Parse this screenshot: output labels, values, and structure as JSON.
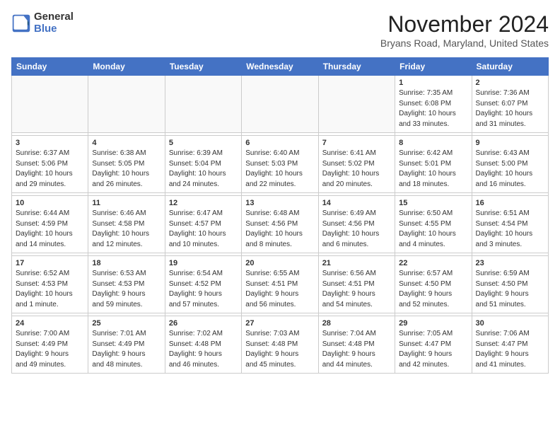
{
  "header": {
    "logo_general": "General",
    "logo_blue": "Blue",
    "month_title": "November 2024",
    "location": "Bryans Road, Maryland, United States"
  },
  "weekdays": [
    "Sunday",
    "Monday",
    "Tuesday",
    "Wednesday",
    "Thursday",
    "Friday",
    "Saturday"
  ],
  "weeks": [
    [
      {
        "day": "",
        "info": ""
      },
      {
        "day": "",
        "info": ""
      },
      {
        "day": "",
        "info": ""
      },
      {
        "day": "",
        "info": ""
      },
      {
        "day": "",
        "info": ""
      },
      {
        "day": "1",
        "info": "Sunrise: 7:35 AM\nSunset: 6:08 PM\nDaylight: 10 hours\nand 33 minutes."
      },
      {
        "day": "2",
        "info": "Sunrise: 7:36 AM\nSunset: 6:07 PM\nDaylight: 10 hours\nand 31 minutes."
      }
    ],
    [
      {
        "day": "3",
        "info": "Sunrise: 6:37 AM\nSunset: 5:06 PM\nDaylight: 10 hours\nand 29 minutes."
      },
      {
        "day": "4",
        "info": "Sunrise: 6:38 AM\nSunset: 5:05 PM\nDaylight: 10 hours\nand 26 minutes."
      },
      {
        "day": "5",
        "info": "Sunrise: 6:39 AM\nSunset: 5:04 PM\nDaylight: 10 hours\nand 24 minutes."
      },
      {
        "day": "6",
        "info": "Sunrise: 6:40 AM\nSunset: 5:03 PM\nDaylight: 10 hours\nand 22 minutes."
      },
      {
        "day": "7",
        "info": "Sunrise: 6:41 AM\nSunset: 5:02 PM\nDaylight: 10 hours\nand 20 minutes."
      },
      {
        "day": "8",
        "info": "Sunrise: 6:42 AM\nSunset: 5:01 PM\nDaylight: 10 hours\nand 18 minutes."
      },
      {
        "day": "9",
        "info": "Sunrise: 6:43 AM\nSunset: 5:00 PM\nDaylight: 10 hours\nand 16 minutes."
      }
    ],
    [
      {
        "day": "10",
        "info": "Sunrise: 6:44 AM\nSunset: 4:59 PM\nDaylight: 10 hours\nand 14 minutes."
      },
      {
        "day": "11",
        "info": "Sunrise: 6:46 AM\nSunset: 4:58 PM\nDaylight: 10 hours\nand 12 minutes."
      },
      {
        "day": "12",
        "info": "Sunrise: 6:47 AM\nSunset: 4:57 PM\nDaylight: 10 hours\nand 10 minutes."
      },
      {
        "day": "13",
        "info": "Sunrise: 6:48 AM\nSunset: 4:56 PM\nDaylight: 10 hours\nand 8 minutes."
      },
      {
        "day": "14",
        "info": "Sunrise: 6:49 AM\nSunset: 4:56 PM\nDaylight: 10 hours\nand 6 minutes."
      },
      {
        "day": "15",
        "info": "Sunrise: 6:50 AM\nSunset: 4:55 PM\nDaylight: 10 hours\nand 4 minutes."
      },
      {
        "day": "16",
        "info": "Sunrise: 6:51 AM\nSunset: 4:54 PM\nDaylight: 10 hours\nand 3 minutes."
      }
    ],
    [
      {
        "day": "17",
        "info": "Sunrise: 6:52 AM\nSunset: 4:53 PM\nDaylight: 10 hours\nand 1 minute."
      },
      {
        "day": "18",
        "info": "Sunrise: 6:53 AM\nSunset: 4:53 PM\nDaylight: 9 hours\nand 59 minutes."
      },
      {
        "day": "19",
        "info": "Sunrise: 6:54 AM\nSunset: 4:52 PM\nDaylight: 9 hours\nand 57 minutes."
      },
      {
        "day": "20",
        "info": "Sunrise: 6:55 AM\nSunset: 4:51 PM\nDaylight: 9 hours\nand 56 minutes."
      },
      {
        "day": "21",
        "info": "Sunrise: 6:56 AM\nSunset: 4:51 PM\nDaylight: 9 hours\nand 54 minutes."
      },
      {
        "day": "22",
        "info": "Sunrise: 6:57 AM\nSunset: 4:50 PM\nDaylight: 9 hours\nand 52 minutes."
      },
      {
        "day": "23",
        "info": "Sunrise: 6:59 AM\nSunset: 4:50 PM\nDaylight: 9 hours\nand 51 minutes."
      }
    ],
    [
      {
        "day": "24",
        "info": "Sunrise: 7:00 AM\nSunset: 4:49 PM\nDaylight: 9 hours\nand 49 minutes."
      },
      {
        "day": "25",
        "info": "Sunrise: 7:01 AM\nSunset: 4:49 PM\nDaylight: 9 hours\nand 48 minutes."
      },
      {
        "day": "26",
        "info": "Sunrise: 7:02 AM\nSunset: 4:48 PM\nDaylight: 9 hours\nand 46 minutes."
      },
      {
        "day": "27",
        "info": "Sunrise: 7:03 AM\nSunset: 4:48 PM\nDaylight: 9 hours\nand 45 minutes."
      },
      {
        "day": "28",
        "info": "Sunrise: 7:04 AM\nSunset: 4:48 PM\nDaylight: 9 hours\nand 44 minutes."
      },
      {
        "day": "29",
        "info": "Sunrise: 7:05 AM\nSunset: 4:47 PM\nDaylight: 9 hours\nand 42 minutes."
      },
      {
        "day": "30",
        "info": "Sunrise: 7:06 AM\nSunset: 4:47 PM\nDaylight: 9 hours\nand 41 minutes."
      }
    ]
  ]
}
